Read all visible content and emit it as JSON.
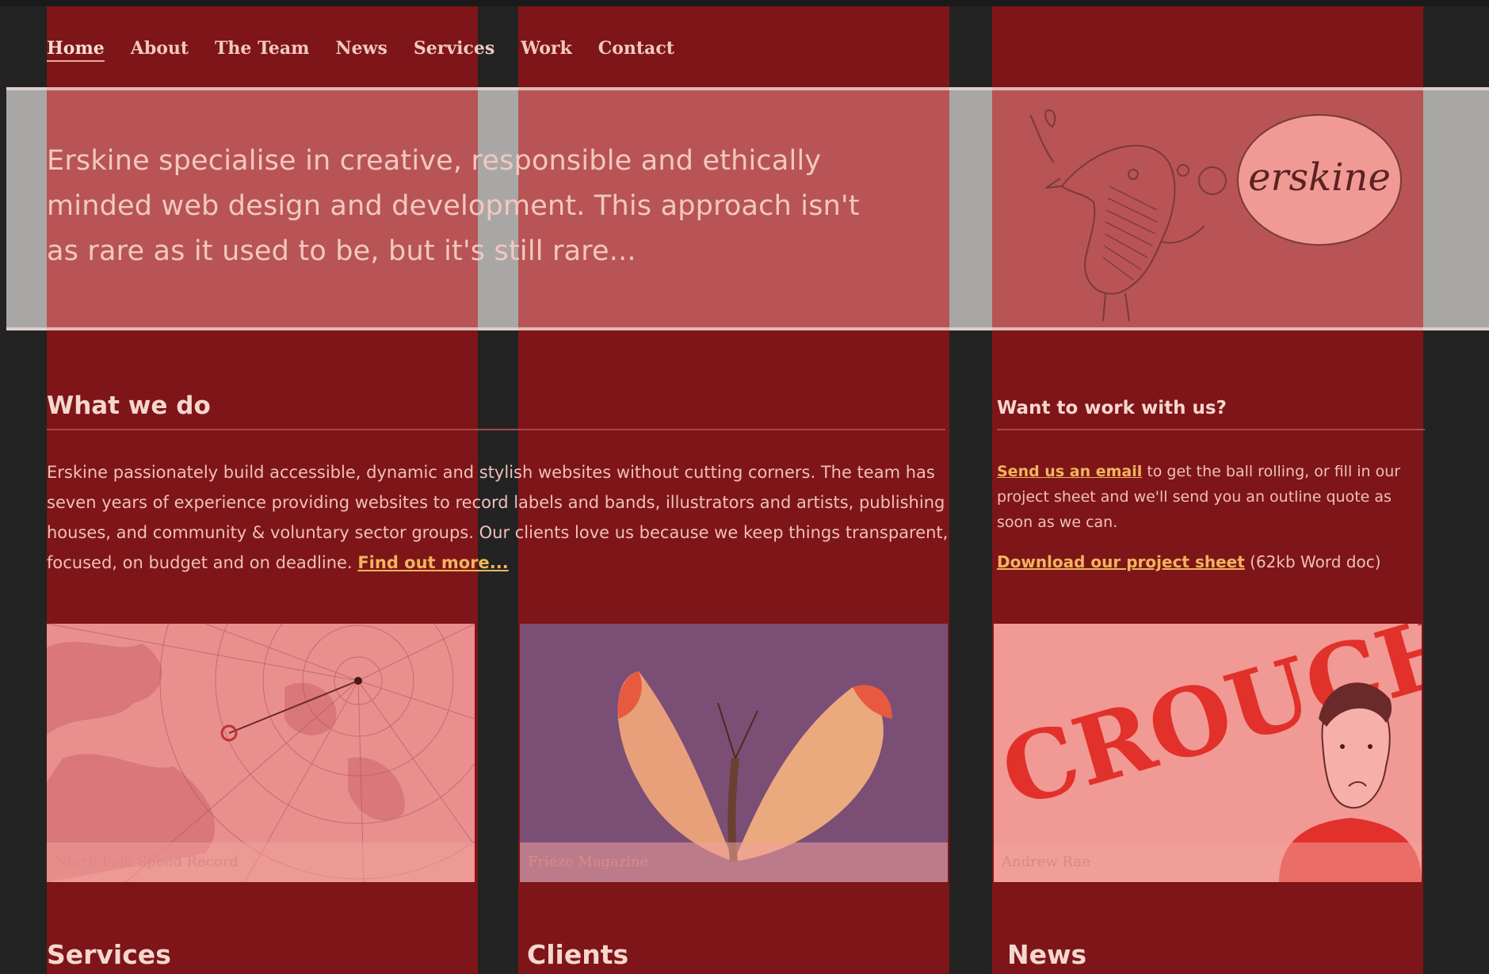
{
  "nav": {
    "items": [
      {
        "label": "Home",
        "active": true
      },
      {
        "label": "About"
      },
      {
        "label": "The Team"
      },
      {
        "label": "News"
      },
      {
        "label": "Services"
      },
      {
        "label": "Work"
      },
      {
        "label": "Contact"
      }
    ]
  },
  "hero": {
    "intro": "Erskine specialise in creative, responsible and ethically minded web design and development. This approach isn't as rare as it used to be, but it's still rare...",
    "logo_text": "erskine"
  },
  "what_we_do": {
    "heading": "What we do",
    "text": "Erskine passionately build accessible, dynamic and stylish websites without cutting corners. The team has seven years of experience providing websites to record labels and bands, illustrators and artists, publishing houses, and community & voluntary sector groups. Our clients love us because we keep things transparent, focused, on budget and on deadline.",
    "link": "Find out more..."
  },
  "want_to_work": {
    "heading": "Want to work with us?",
    "email_link": "Send us an email",
    "text": "to get the ball rolling, or fill in our project sheet and we'll send you an outline quote as soon as we can.",
    "download_link": "Download our project sheet",
    "download_meta": "(62kb Word doc)"
  },
  "thumbnails": [
    {
      "caption": "North Pole Speed Record"
    },
    {
      "caption": "Frieze Magazine"
    },
    {
      "caption": "Andrew Rae",
      "poster_text": "CROUCH"
    }
  ],
  "footer_headings": {
    "services": "Services",
    "clients": "Clients",
    "news": "News"
  },
  "colors": {
    "background": "#232323",
    "column": "#7e1518",
    "band": "#b85455",
    "link": "#f0b55d"
  }
}
